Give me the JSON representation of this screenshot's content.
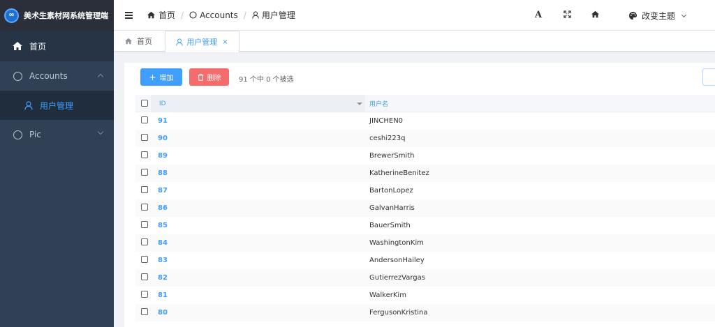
{
  "app": {
    "title": "美术生素材网系统管理端",
    "logo_glyph": "∞"
  },
  "sidebar": {
    "items": [
      {
        "label": "首页",
        "icon": "home-icon"
      },
      {
        "label": "Accounts",
        "icon": "circle-icon",
        "expanded": true
      },
      {
        "label": "用户管理",
        "icon": "user-icon",
        "active": true
      },
      {
        "label": "Pic",
        "icon": "circle-icon",
        "expanded": false
      }
    ]
  },
  "navbar": {
    "breadcrumb": [
      "首页",
      "Accounts",
      "用户管理"
    ],
    "font_icon_glyph": "A",
    "theme_label": "改变主题"
  },
  "tags": {
    "home": "首页",
    "users": "用户管理",
    "close_glyph": "×"
  },
  "toolbar": {
    "add_label": "增加",
    "delete_label": "删除",
    "selection_info": "91 个中 0 个被选"
  },
  "table": {
    "columns": [
      "ID",
      "用户名"
    ],
    "rows": [
      {
        "id": "91",
        "username": "JINCHEN0"
      },
      {
        "id": "90",
        "username": "ceshi223q"
      },
      {
        "id": "89",
        "username": "BrewerSmith"
      },
      {
        "id": "88",
        "username": "KatherineBenitez"
      },
      {
        "id": "87",
        "username": "BartonLopez"
      },
      {
        "id": "86",
        "username": "GalvanHarris"
      },
      {
        "id": "85",
        "username": "BauerSmith"
      },
      {
        "id": "84",
        "username": "WashingtonKim"
      },
      {
        "id": "83",
        "username": "AndersonHailey"
      },
      {
        "id": "82",
        "username": "GutierrezVargas"
      },
      {
        "id": "81",
        "username": "WalkerKim"
      },
      {
        "id": "80",
        "username": "FergusonKristina"
      }
    ]
  },
  "colors": {
    "sidebar_bg": "#304156",
    "accent": "#409eff",
    "danger": "#f56c6c"
  }
}
